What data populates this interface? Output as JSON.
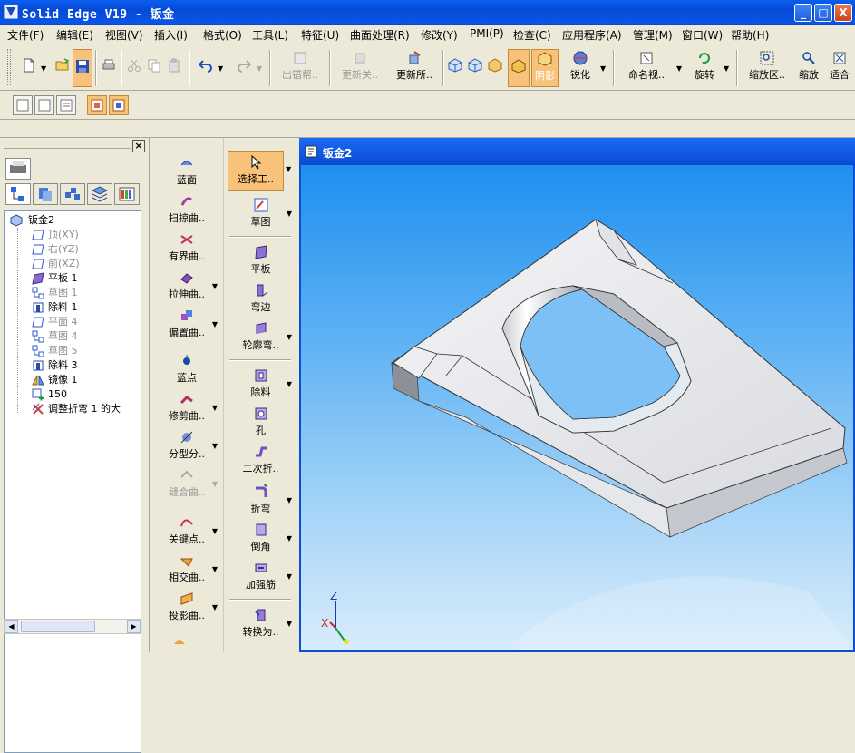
{
  "window": {
    "title": "Solid Edge V19 - 钣金",
    "min_glyph": "_",
    "max_glyph": "□",
    "close_glyph": "X"
  },
  "menu": [
    "文件(F)",
    "编辑(E)",
    "视图(V)",
    "插入(I)",
    "格式(O)",
    "工具(L)",
    "特征(U)",
    "曲面处理(R)",
    "修改(Y)",
    "PMI(P)",
    "检查(C)",
    "应用程序(A)",
    "管理(M)",
    "窗口(W)",
    "帮助(H)"
  ],
  "toolbar": {
    "new_icon": "new-document-icon",
    "open_icon": "open-folder-icon",
    "save_icon": "save-icon",
    "print_icon": "print-icon",
    "cut_icon": "cut-icon",
    "copy_icon": "copy-icon",
    "paste_icon": "paste-icon",
    "undo_icon": "undo-icon",
    "redo_icon": "redo-icon",
    "error_assistant": "出错帮..",
    "update_related": "更新关..",
    "update_all": "更新所..",
    "shading": "阴影",
    "sharpen": "锐化",
    "named_view": "命名视..",
    "rotate": "旋转",
    "zoom_area": "缩放区..",
    "zoom": "缩放",
    "fit": "适合"
  },
  "left_panel": {
    "close_glyph": "×",
    "tree_title": "钣金2",
    "tree": [
      {
        "label": "顶(XY)",
        "icon": "plane-icon",
        "dim": true
      },
      {
        "label": "右(YZ)",
        "icon": "plane-icon",
        "dim": true
      },
      {
        "label": "前(XZ)",
        "icon": "plane-icon",
        "dim": true
      },
      {
        "label": "平板 1",
        "icon": "tab-icon",
        "dim": false
      },
      {
        "label": "草图 1",
        "icon": "sketch-icon",
        "dim": true
      },
      {
        "label": "除料 1",
        "icon": "cutout-icon",
        "dim": false
      },
      {
        "label": "平面 4",
        "icon": "plane-icon",
        "dim": true
      },
      {
        "label": "草图 4",
        "icon": "sketch-icon",
        "dim": true
      },
      {
        "label": "草图 5",
        "icon": "sketch-icon",
        "dim": true
      },
      {
        "label": "除料 3",
        "icon": "cutout-icon",
        "dim": false
      },
      {
        "label": "镜像 1",
        "icon": "mirror-icon",
        "dim": false
      },
      {
        "label": "150",
        "icon": "dimension-icon",
        "dim": false
      },
      {
        "label": "调整折弯 1 的大",
        "icon": "adjust-bend-icon",
        "dim": false
      }
    ]
  },
  "commands_col1": [
    {
      "label": "蓝面",
      "arrow": false,
      "disabled": false
    },
    {
      "label": "扫掠曲..",
      "arrow": false,
      "disabled": false
    },
    {
      "label": "有界曲..",
      "arrow": false,
      "disabled": false
    },
    {
      "label": "拉伸曲..",
      "arrow": true,
      "disabled": false
    },
    {
      "label": "偏置曲..",
      "arrow": true,
      "disabled": false
    },
    {
      "label": "蓝点",
      "arrow": false,
      "disabled": false
    },
    {
      "label": "修剪曲..",
      "arrow": true,
      "disabled": false
    },
    {
      "label": "分型分..",
      "arrow": true,
      "disabled": false
    },
    {
      "label": "缝合曲..",
      "arrow": true,
      "disabled": true
    },
    {
      "label": "关键点..",
      "arrow": true,
      "disabled": false
    },
    {
      "label": "相交曲..",
      "arrow": true,
      "disabled": false
    },
    {
      "label": "投影曲..",
      "arrow": true,
      "disabled": false
    }
  ],
  "commands_col2": [
    {
      "label": "选择工..",
      "arrow": true,
      "pressed": true
    },
    {
      "label": "草图",
      "arrow": true,
      "pressed": false
    },
    {
      "label": "平板",
      "arrow": false,
      "pressed": false
    },
    {
      "label": "弯边",
      "arrow": false,
      "pressed": false
    },
    {
      "label": "轮廓弯..",
      "arrow": true,
      "pressed": false
    },
    {
      "label": "除料",
      "arrow": true,
      "pressed": false
    },
    {
      "label": "孔",
      "arrow": false,
      "pressed": false
    },
    {
      "label": "二次折..",
      "arrow": false,
      "pressed": false
    },
    {
      "label": "折弯",
      "arrow": true,
      "pressed": false
    },
    {
      "label": "倒角",
      "arrow": true,
      "pressed": false
    },
    {
      "label": "加强筋",
      "arrow": true,
      "pressed": false
    },
    {
      "label": "转换为..",
      "arrow": true,
      "pressed": false
    }
  ],
  "viewport": {
    "title": "钣金2",
    "axis_z": "Z",
    "axis_x": "X"
  },
  "colors": {
    "title_blue": "#0a5ef0",
    "pressed_orange": "#f8c27a",
    "sky_top": "#1e8fef",
    "sky_bottom": "#d8ecfb"
  }
}
